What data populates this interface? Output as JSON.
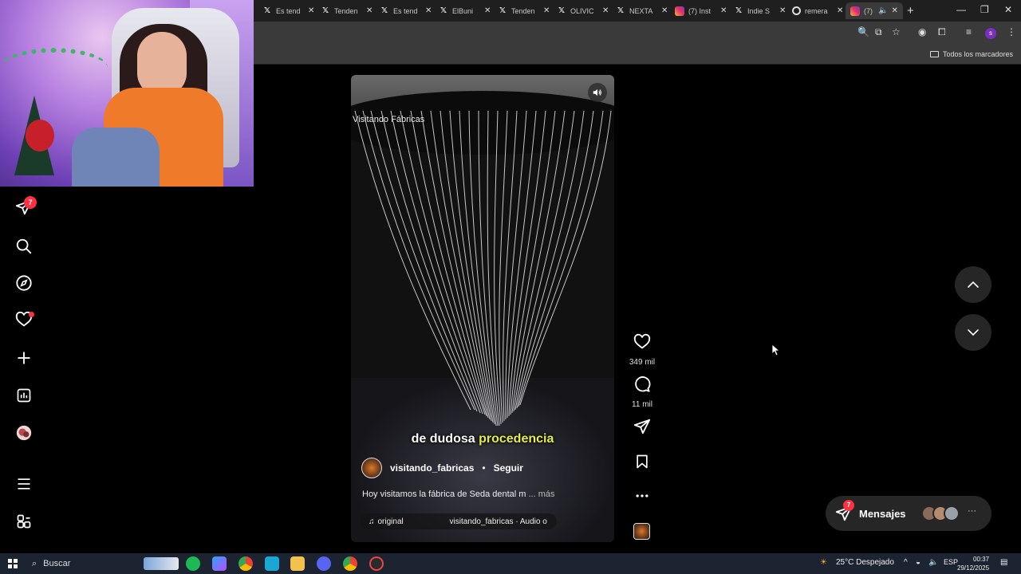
{
  "browser": {
    "tabs": [
      {
        "label": "Es tend",
        "icon": "x-logo-icon"
      },
      {
        "label": "Tenden",
        "icon": "x-logo-icon"
      },
      {
        "label": "Es tend",
        "icon": "x-logo-icon"
      },
      {
        "label": "ElBuni",
        "icon": "x-logo-icon"
      },
      {
        "label": "Tenden",
        "icon": "x-logo-icon"
      },
      {
        "label": "OLIVIC",
        "icon": "x-logo-icon"
      },
      {
        "label": "NEXTA",
        "icon": "x-logo-icon"
      },
      {
        "label": "(7) Inst",
        "icon": "instagram-icon"
      },
      {
        "label": "Indie S",
        "icon": "x-logo-icon"
      },
      {
        "label": "remera",
        "icon": "google-icon"
      },
      {
        "label": "(7)",
        "icon": "instagram-icon",
        "active": true
      }
    ],
    "new_tab": "+",
    "profile_initial": "s",
    "bookmarks_all": "Todos los marcadores"
  },
  "sidebar": {
    "direct_badge": "7"
  },
  "reel": {
    "watermark": "Visitando Fábricas",
    "subtitle_plain": "de dudosa",
    "subtitle_highlight": "procedencia",
    "author": "visitando_fabricas",
    "dot": "•",
    "follow": "Seguir",
    "description": "Hoy visitamos la fábrica de Seda dental m",
    "more": "... más",
    "audio_left": "original",
    "audio_right": "visitando_fabricas · Audio o"
  },
  "actions": {
    "likes": "349 mil",
    "comments": "11 mil"
  },
  "messages": {
    "label": "Mensajes",
    "badge": "7",
    "more": "···"
  },
  "taskbar": {
    "search": "Buscar",
    "weather": "25°C Despejado",
    "lang": "ESP",
    "time": "00:37",
    "date": "29/12/2025"
  },
  "colors": {
    "badge": "#ff3040",
    "highlight": "#e6ef3a",
    "panel": "#262626"
  }
}
